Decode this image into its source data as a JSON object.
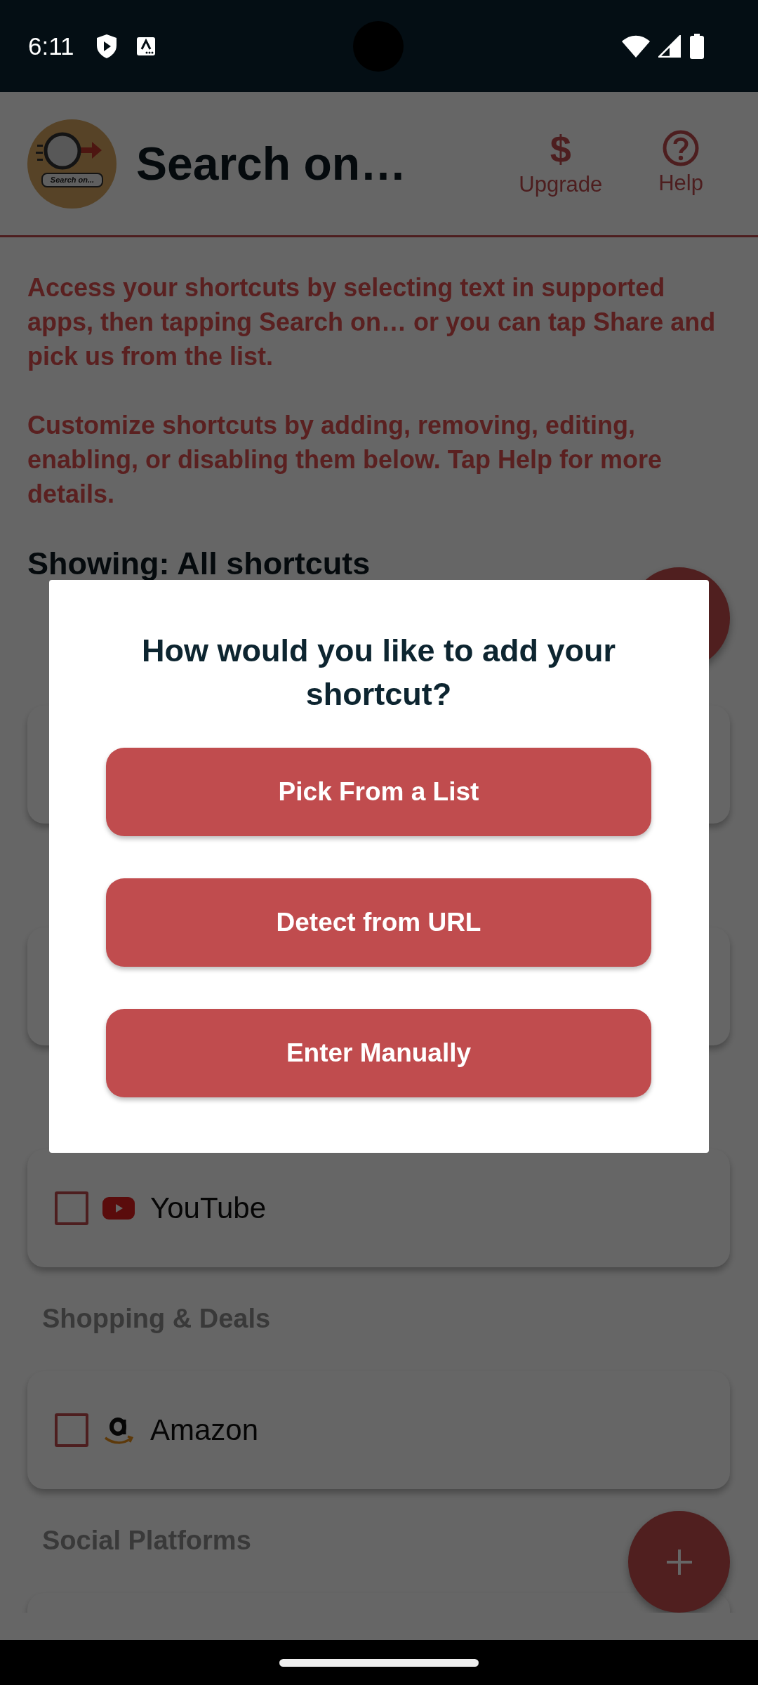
{
  "status_bar": {
    "time": "6:11"
  },
  "app_bar": {
    "logo_text": "Search on...",
    "title": "Search on…",
    "actions": [
      {
        "kind": "upgrade",
        "glyph": "$",
        "label": "Upgrade"
      },
      {
        "kind": "help",
        "label": "Help"
      }
    ]
  },
  "intro": [
    "Access your shortcuts by selecting text in supported apps, then tapping Search on… or you can tap Share and pick us from the list.",
    "Customize shortcuts by adding, removing, editing, enabling, or disabling them below. Tap Help for more details."
  ],
  "filter_heading": "Showing: All shortcuts",
  "sections": [
    {
      "kind": "covered"
    },
    {
      "kind": "covered"
    },
    {
      "kind": "shown",
      "items": [
        {
          "name": "YouTube",
          "kind": "video",
          "checked": false
        }
      ]
    },
    {
      "kind": "shown",
      "heading": "Shopping & Deals",
      "items": [
        {
          "name": "Amazon",
          "kind": "store",
          "checked": false
        }
      ]
    },
    {
      "kind": "shown",
      "heading": "Social Platforms"
    }
  ],
  "dialog": {
    "title": "How would you like to add your shortcut?",
    "options": [
      "Pick From a List",
      "Detect from URL",
      "Enter Manually"
    ]
  }
}
